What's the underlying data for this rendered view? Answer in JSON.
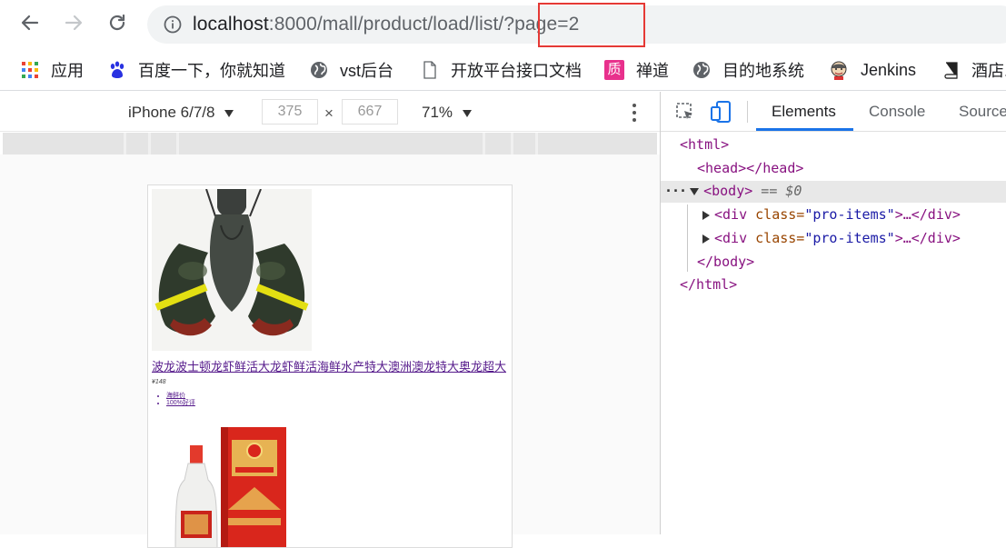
{
  "browser": {
    "url_host": "localhost",
    "url_rest": ":8000/mall/product/load/list/?page=2"
  },
  "bookmarks": [
    {
      "label": "应用",
      "icon": "apps-grid-icon"
    },
    {
      "label": "百度一下，你就知道",
      "icon": "baidu-paw-icon"
    },
    {
      "label": "vst后台",
      "icon": "globe-icon"
    },
    {
      "label": "开放平台接口文档",
      "icon": "document-icon"
    },
    {
      "label": "禅道",
      "icon": "zentao-icon",
      "icon_text": "质"
    },
    {
      "label": "目的地系统",
      "icon": "globe-icon"
    },
    {
      "label": "Jenkins",
      "icon": "jenkins-icon"
    },
    {
      "label": "酒店...",
      "icon": "book-icon"
    }
  ],
  "device_toolbar": {
    "device": "iPhone 6/7/8",
    "width": "375",
    "height": "667",
    "times": "×",
    "zoom": "71%"
  },
  "page": {
    "product_title": "波龙波士顿龙虾鲜活大龙虾鲜活海鲜水产特大澳洲澳龙特大奥龙超大",
    "product_price": "¥148",
    "list_items": [
      "海鲜价",
      "100%好评"
    ]
  },
  "devtools": {
    "tabs": [
      "Elements",
      "Console",
      "Sources"
    ],
    "active_tab": "Elements",
    "tree": {
      "html_open": "<html>",
      "head": "<head></head>",
      "body_open": "<body>",
      "body_eq": " == $0",
      "div_tag": "<div",
      "div_attr": " class=",
      "div_val": "\"pro-items\"",
      "div_close": ">…</div>",
      "body_close": "</body>",
      "html_close": "</html>"
    }
  },
  "colors": {
    "highlight_box": "#e53935",
    "devtools_accent": "#1a73e8"
  }
}
